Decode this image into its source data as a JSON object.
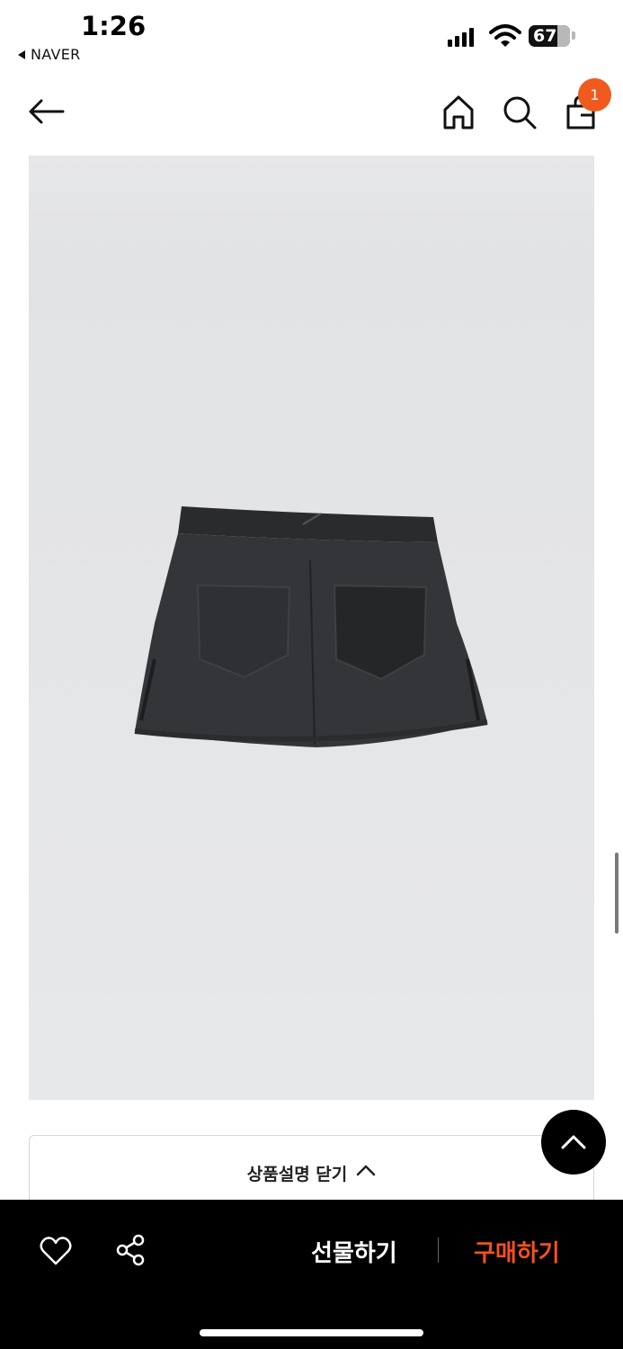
{
  "status_bar": {
    "time": "1:26",
    "back_app": "NAVER",
    "battery": "67"
  },
  "nav": {
    "cart_count": "1",
    "icons": [
      "back-arrow-icon",
      "home-icon",
      "search-icon",
      "shopping-bag-icon"
    ]
  },
  "product": {
    "description_toggle": "상품설명 닫기"
  },
  "bottom_bar": {
    "gift_label": "선물하기",
    "buy_label": "구매하기",
    "icons": [
      "heart-icon",
      "share-icon"
    ]
  },
  "colors": {
    "accent": "#f4511e",
    "badge": "#f05a1e",
    "bar_bg": "#000000"
  }
}
